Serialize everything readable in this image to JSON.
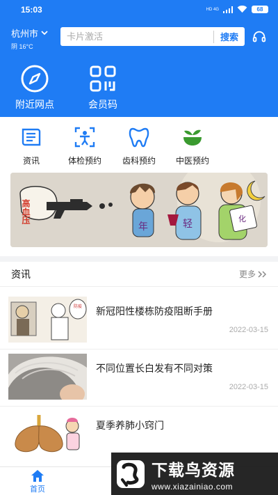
{
  "status_bar": {
    "time": "15:03",
    "signal_label": "HD 4G",
    "battery": "68"
  },
  "location": {
    "city": "杭州市",
    "weather": "阴 16°C"
  },
  "search": {
    "placeholder": "卡片激活",
    "button": "搜索"
  },
  "quick_actions": [
    {
      "label": "附近网点",
      "icon": "compass-icon"
    },
    {
      "label": "会员码",
      "icon": "qr-code-icon"
    }
  ],
  "services": [
    {
      "label": "资讯",
      "icon": "news-book-icon"
    },
    {
      "label": "体检预约",
      "icon": "body-scan-icon"
    },
    {
      "label": "齿科预约",
      "icon": "tooth-icon"
    },
    {
      "label": "中医预约",
      "icon": "herb-mortar-icon"
    }
  ],
  "banner": {
    "labels": [
      "高血压",
      "年",
      "轻",
      "化"
    ]
  },
  "news": {
    "title": "资讯",
    "more": "更多",
    "items": [
      {
        "title": "新冠阳性楼栋防疫阻断手册",
        "date": "2022-03-15"
      },
      {
        "title": "不同位置长白发有不同对策",
        "date": "2022-03-15"
      },
      {
        "title": "夏季养肺小窍门",
        "date": ""
      }
    ]
  },
  "bottom_nav": {
    "home": "首页"
  },
  "watermark": {
    "title": "下载鸟资源",
    "url": "www.xiazainiao.com"
  },
  "colors": {
    "primary": "#1f7cf4",
    "green": "#3a9a2f",
    "background": "#f2f3f5"
  }
}
